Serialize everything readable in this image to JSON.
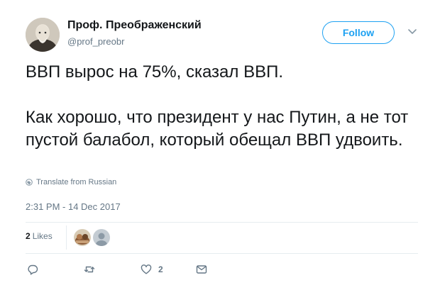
{
  "author": {
    "name": "Проф. Преображенский",
    "handle": "@prof_preobr",
    "follow_label": "Follow"
  },
  "tweet": {
    "paragraphs": [
      "ВВП вырос на 75%, сказал ВВП.",
      "Как хорошо, что президент у нас Путин, а не тот пустой балабол, который обещал ВВП удвоить."
    ],
    "translate_label": "Translate from Russian",
    "timestamp": "2:31 PM - 14 Dec 2017"
  },
  "engagement": {
    "likes_count": "2",
    "likes_label": "Likes"
  },
  "actions": {
    "reply_icon": "reply-icon",
    "retweet_icon": "retweet-icon",
    "like_icon": "heart-icon",
    "like_count": "2",
    "message_icon": "direct-message-icon"
  },
  "colors": {
    "accent": "#1da1f2",
    "secondary_text": "#657786",
    "primary_text": "#14171a",
    "divider": "#e6ecf0"
  }
}
